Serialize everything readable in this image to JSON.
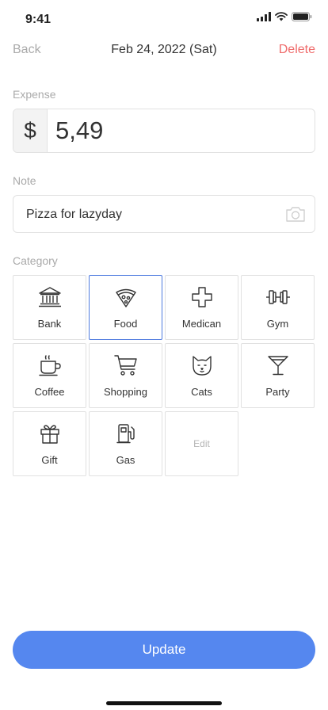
{
  "status_bar": {
    "time": "9:41"
  },
  "nav": {
    "back": "Back",
    "title": "Feb 24, 2022 (Sat)",
    "delete": "Delete",
    "delete_color": "#ef6b6b"
  },
  "expense": {
    "label": "Expense",
    "currency": "$",
    "value": "5,49"
  },
  "note": {
    "label": "Note",
    "value": "Pizza for lazyday"
  },
  "category": {
    "label": "Category",
    "selected": "Food",
    "items": [
      {
        "label": "Bank",
        "icon": "bank-icon"
      },
      {
        "label": "Food",
        "icon": "pizza-icon"
      },
      {
        "label": "Medican",
        "icon": "medical-cross-icon"
      },
      {
        "label": "Gym",
        "icon": "dumbbell-icon"
      },
      {
        "label": "Coffee",
        "icon": "coffee-cup-icon"
      },
      {
        "label": "Shopping",
        "icon": "shopping-cart-icon"
      },
      {
        "label": "Cats",
        "icon": "cat-icon"
      },
      {
        "label": "Party",
        "icon": "cocktail-icon"
      },
      {
        "label": "Gift",
        "icon": "gift-icon"
      },
      {
        "label": "Gas",
        "icon": "gas-pump-icon"
      }
    ],
    "edit_label": "Edit"
  },
  "update_button": {
    "label": "Update",
    "color": "#5587ef"
  },
  "colors": {
    "accent": "#5587ef",
    "selected_border": "#4f7bdf",
    "danger": "#ef6b6b"
  }
}
